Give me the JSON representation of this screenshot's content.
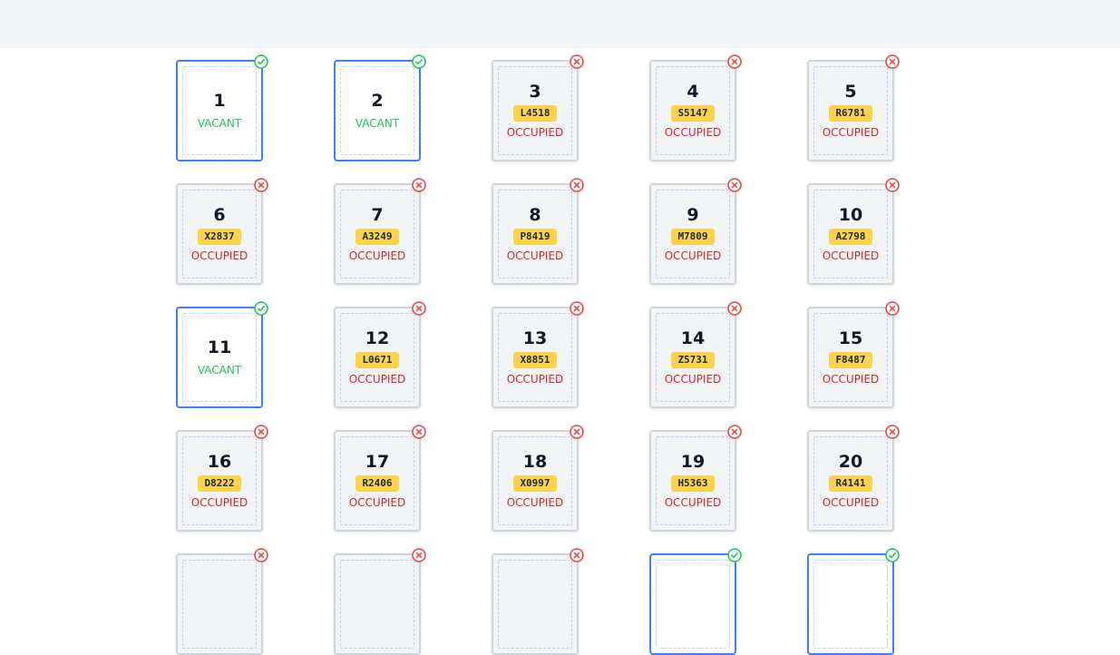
{
  "colors": {
    "vacant_border": "#3b82f6",
    "vacant_text": "#22c55e",
    "occupied_text": "#dc2626",
    "plate_bg": "#fcd34d"
  },
  "slots": [
    {
      "number": "1",
      "status": "VACANT",
      "plate": "",
      "icon": "check-circle-icon"
    },
    {
      "number": "2",
      "status": "VACANT",
      "plate": "",
      "icon": "check-circle-icon"
    },
    {
      "number": "3",
      "status": "OCCUPIED",
      "plate": "L4518",
      "icon": "x-circle-icon"
    },
    {
      "number": "4",
      "status": "OCCUPIED",
      "plate": "S5147",
      "icon": "x-circle-icon"
    },
    {
      "number": "5",
      "status": "OCCUPIED",
      "plate": "R6781",
      "icon": "x-circle-icon"
    },
    {
      "number": "6",
      "status": "OCCUPIED",
      "plate": "X2837",
      "icon": "x-circle-icon"
    },
    {
      "number": "7",
      "status": "OCCUPIED",
      "plate": "A3249",
      "icon": "x-circle-icon"
    },
    {
      "number": "8",
      "status": "OCCUPIED",
      "plate": "P8419",
      "icon": "x-circle-icon"
    },
    {
      "number": "9",
      "status": "OCCUPIED",
      "plate": "M7809",
      "icon": "x-circle-icon"
    },
    {
      "number": "10",
      "status": "OCCUPIED",
      "plate": "A2798",
      "icon": "x-circle-icon"
    },
    {
      "number": "11",
      "status": "VACANT",
      "plate": "",
      "icon": "check-circle-icon"
    },
    {
      "number": "12",
      "status": "OCCUPIED",
      "plate": "L0671",
      "icon": "x-circle-icon"
    },
    {
      "number": "13",
      "status": "OCCUPIED",
      "plate": "X8851",
      "icon": "x-circle-icon"
    },
    {
      "number": "14",
      "status": "OCCUPIED",
      "plate": "Z5731",
      "icon": "x-circle-icon"
    },
    {
      "number": "15",
      "status": "OCCUPIED",
      "plate": "F8487",
      "icon": "x-circle-icon"
    },
    {
      "number": "16",
      "status": "OCCUPIED",
      "plate": "D8222",
      "icon": "x-circle-icon"
    },
    {
      "number": "17",
      "status": "OCCUPIED",
      "plate": "R2406",
      "icon": "x-circle-icon"
    },
    {
      "number": "18",
      "status": "OCCUPIED",
      "plate": "X0997",
      "icon": "x-circle-icon"
    },
    {
      "number": "19",
      "status": "OCCUPIED",
      "plate": "H5363",
      "icon": "x-circle-icon"
    },
    {
      "number": "20",
      "status": "OCCUPIED",
      "plate": "R4141",
      "icon": "x-circle-icon"
    },
    {
      "number": "",
      "status": "",
      "plate": "",
      "icon": "x-circle-icon",
      "state": "occupied"
    },
    {
      "number": "",
      "status": "",
      "plate": "",
      "icon": "x-circle-icon",
      "state": "occupied"
    },
    {
      "number": "",
      "status": "",
      "plate": "",
      "icon": "x-circle-icon",
      "state": "occupied"
    },
    {
      "number": "",
      "status": "",
      "plate": "",
      "icon": "check-circle-icon",
      "state": "vacant"
    },
    {
      "number": "",
      "status": "",
      "plate": "",
      "icon": "check-circle-icon",
      "state": "vacant"
    }
  ]
}
